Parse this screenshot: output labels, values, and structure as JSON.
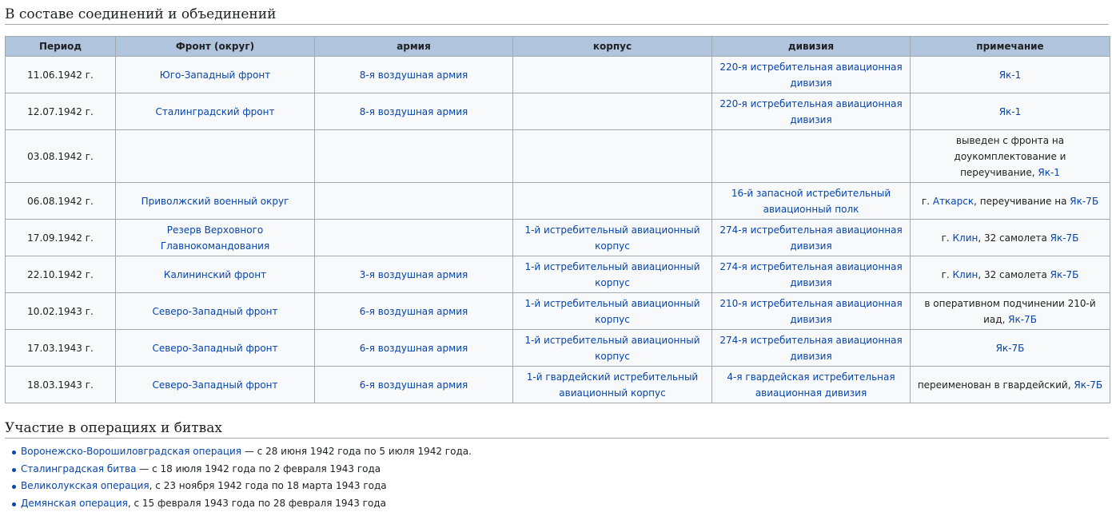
{
  "section1": {
    "title": "В составе соединений и объединений"
  },
  "table": {
    "headers": [
      "Период",
      "Фронт (округ)",
      "армия",
      "корпус",
      "дивизия",
      "примечание"
    ],
    "rows": [
      {
        "period": "11.06.1942 г.",
        "front": "Юго-Западный фронт",
        "army": "8-я воздушная армия",
        "corps": "",
        "division": "220-я истребительная авиационная дивизия",
        "note": {
          "parts": [
            {
              "text": "Як-1",
              "link": true
            }
          ]
        }
      },
      {
        "period": "12.07.1942 г.",
        "front": "Сталинградский фронт",
        "army": "8-я воздушная армия",
        "corps": "",
        "division": "220-я истребительная авиационная дивизия",
        "note": {
          "parts": [
            {
              "text": "Як-1",
              "link": true
            }
          ]
        }
      },
      {
        "period": "03.08.1942 г.",
        "front": "",
        "army": "",
        "corps": "",
        "division": "",
        "tall": true,
        "note": {
          "parts": [
            {
              "text": "выведен с фронта на доукомплектование и переучивание, ",
              "link": false
            },
            {
              "text": "Як-1",
              "link": true
            }
          ]
        }
      },
      {
        "period": "06.08.1942 г.",
        "front": "Приволжский военный округ",
        "army": "",
        "corps": "",
        "division": "16-й запасной истребительный авиационный полк",
        "note": {
          "parts": [
            {
              "text": "г. ",
              "link": false
            },
            {
              "text": "Аткарск",
              "link": true
            },
            {
              "text": ", переучивание на ",
              "link": false
            },
            {
              "text": "Як-7Б",
              "link": true
            }
          ]
        }
      },
      {
        "period": "17.09.1942 г.",
        "front": "Резерв Верховного Главнокомандования",
        "army": "",
        "corps": "1-й истребительный авиационный корпус",
        "division": "274-я истребительная авиационная дивизия",
        "note": {
          "parts": [
            {
              "text": "г. ",
              "link": false
            },
            {
              "text": "Клин",
              "link": true
            },
            {
              "text": ", 32 самолета ",
              "link": false
            },
            {
              "text": "Як-7Б",
              "link": true
            }
          ]
        }
      },
      {
        "period": "22.10.1942 г.",
        "front": "Калининский фронт",
        "army": "3-я воздушная армия",
        "corps": "1-й истребительный авиационный корпус",
        "division": "274-я истребительная авиационная дивизия",
        "note": {
          "parts": [
            {
              "text": "г. ",
              "link": false
            },
            {
              "text": "Клин",
              "link": true
            },
            {
              "text": ", 32 самолета ",
              "link": false
            },
            {
              "text": "Як-7Б",
              "link": true
            }
          ]
        }
      },
      {
        "period": "10.02.1943 г.",
        "front": "Северо-Западный фронт",
        "army": "6-я воздушная армия",
        "corps": "1-й истребительный авиационный корпус",
        "division": "210-я истребительная авиационная дивизия",
        "note": {
          "parts": [
            {
              "text": "в оперативном подчинении 210-й иад, ",
              "link": false
            },
            {
              "text": "Як-7Б",
              "link": true
            }
          ]
        }
      },
      {
        "period": "17.03.1943 г.",
        "front": "Северо-Западный фронт",
        "army": "6-я воздушная армия",
        "corps": "1-й истребительный авиационный корпус",
        "division": "274-я истребительная авиационная дивизия",
        "note": {
          "parts": [
            {
              "text": "Як-7Б",
              "link": true
            }
          ]
        }
      },
      {
        "period": "18.03.1943 г.",
        "front": "Северо-Западный фронт",
        "army": "6-я воздушная армия",
        "corps": "1-й гвардейский истребительный авиационный корпус",
        "division": "4-я гвардейская истребительная авиационная дивизия",
        "note": {
          "parts": [
            {
              "text": "переименован в гвардейский, ",
              "link": false
            },
            {
              "text": "Як-7Б",
              "link": true
            }
          ]
        }
      }
    ]
  },
  "section2": {
    "title": "Участие в операциях и битвах"
  },
  "operations": [
    {
      "link": "Воронежско-Ворошиловградская операция",
      "rest": " — с 28 июня 1942 года по 5 июля 1942 года."
    },
    {
      "link": "Сталинградская битва",
      "rest": " — с 18 июля 1942 года по 2 февраля 1943 года"
    },
    {
      "link": "Великолукская операция",
      "rest": ", с 23 ноября 1942 года по 18 марта 1943 года"
    },
    {
      "link": "Демянская операция",
      "rest": ", с 15 февраля 1943 года по 28 февраля 1943 года"
    }
  ],
  "colors": {
    "link": "#0645ad",
    "header_bg": "#b0c4de",
    "cell_bg": "#f8f9fa",
    "border": "#a2a9b1"
  }
}
